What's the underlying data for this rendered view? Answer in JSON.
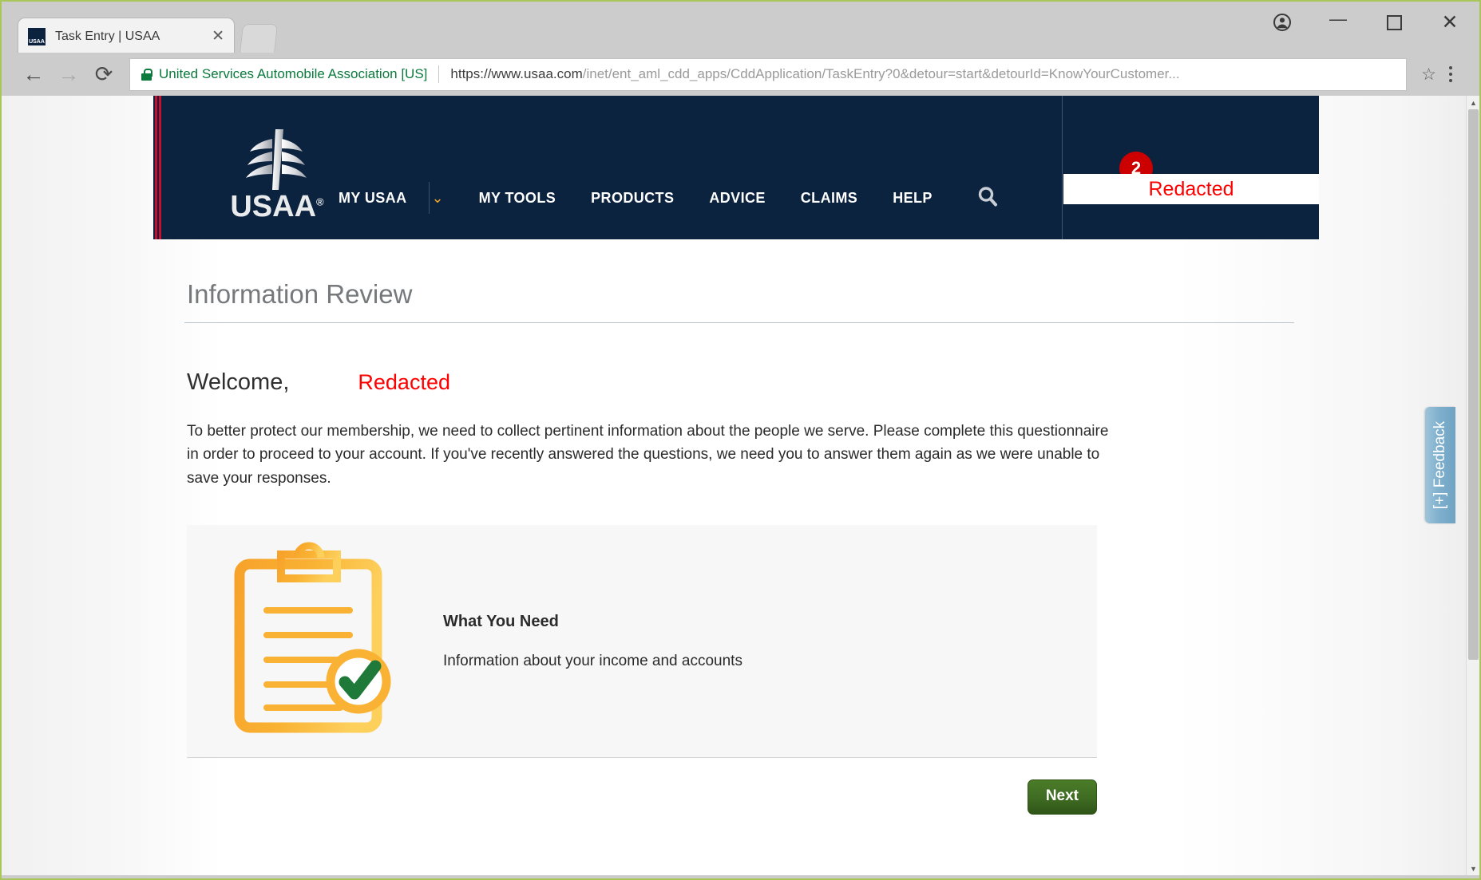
{
  "browser": {
    "tab": {
      "title": "Task Entry | USAA",
      "favicon_label": "USAA",
      "close_label": "✕"
    },
    "new_tab_name": "new-tab",
    "window_controls": {
      "profile": "profile-icon",
      "minimize": "—",
      "maximize": "maximize",
      "close": "✕"
    },
    "nav": {
      "back": "←",
      "forward": "→",
      "reload": "⟳"
    },
    "omnibox": {
      "site_identity": "United Services Automobile Association [US]",
      "url_host": "https://www.usaa.com",
      "url_path": "/inet/ent_aml_cdd_apps/CddApplication/TaskEntry?0&detour=start&detourId=KnowYourCustomer...",
      "star": "☆"
    }
  },
  "site_header": {
    "logo_wordmark": "USAA",
    "logo_registered": "®",
    "nav_items": [
      {
        "label": "MY USAA"
      },
      {
        "label": "MY TOOLS"
      },
      {
        "label": "PRODUCTS"
      },
      {
        "label": "ADVICE"
      },
      {
        "label": "CLAIMS"
      },
      {
        "label": "HELP"
      }
    ],
    "caret": "⌄",
    "alert_badge_count": "2",
    "redacted_banner": "Redacted"
  },
  "page": {
    "title": "Information Review",
    "welcome_label": "Welcome,",
    "welcome_redacted": "Redacted",
    "intro_paragraph": "To better protect our membership, we need to collect pertinent information about the people we serve. Please complete this questionnaire in order to proceed to your account. If you've recently answered the questions, we need you to answer them again as we were unable to save your responses.",
    "need_card": {
      "title": "What You Need",
      "body": "Information about your income and accounts",
      "illustration": "clipboard-checkmark-icon"
    },
    "next_button": "Next"
  },
  "feedback_tab": {
    "label": "[+] Feedback"
  },
  "scrollbar": {
    "up_arrow": "▲",
    "down_arrow": "▼"
  },
  "colors": {
    "usaa_navy": "#0c2340",
    "usaa_red": "#c8102e",
    "redacted_red": "#ff0000",
    "next_green": "#3f6b22",
    "accent_gold": "#f5a623",
    "feedback_blue": "#7fb0cd"
  }
}
